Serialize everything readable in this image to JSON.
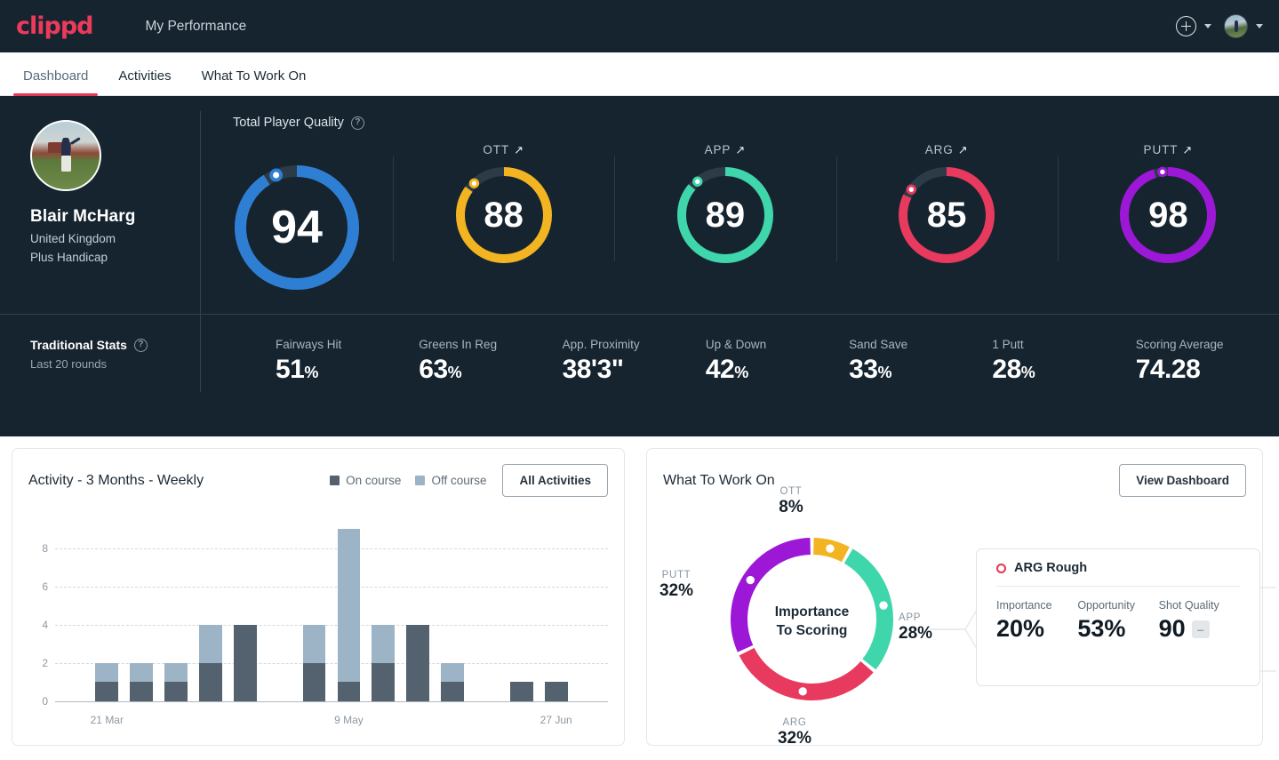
{
  "brand": {
    "logo_text": "clippd",
    "accent": "#ec3a5b"
  },
  "header": {
    "app_title": "My Performance",
    "add_icon": "plus-circle-icon",
    "chevron_icon": "chevron-down-icon",
    "avatar_icon": "user-avatar"
  },
  "tabs": [
    {
      "label": "Dashboard",
      "active": true
    },
    {
      "label": "Activities",
      "active": false
    },
    {
      "label": "What To Work On",
      "active": false
    }
  ],
  "profile": {
    "name": "Blair McHarg",
    "country": "United Kingdom",
    "handicap": "Plus Handicap"
  },
  "tpq": {
    "label": "Total Player Quality",
    "help_icon": "question-mark-icon"
  },
  "gauges": [
    {
      "title": "",
      "value": "94",
      "color": "#2e7fd4",
      "pct": 94,
      "main": true,
      "trend": ""
    },
    {
      "title": "OTT",
      "value": "88",
      "color": "#f2b521",
      "pct": 88,
      "main": false,
      "trend": "↗"
    },
    {
      "title": "APP",
      "value": "89",
      "color": "#3fd6ab",
      "pct": 89,
      "main": false,
      "trend": "↗"
    },
    {
      "title": "ARG",
      "value": "85",
      "color": "#e8395e",
      "pct": 85,
      "main": false,
      "trend": "↗"
    },
    {
      "title": "PUTT",
      "value": "98",
      "color": "#9c18d6",
      "pct": 98,
      "main": false,
      "trend": "↗"
    }
  ],
  "traditional_stats": {
    "title": "Traditional Stats",
    "help_icon": "question-mark-icon",
    "subtitle": "Last 20 rounds",
    "items": [
      {
        "label": "Fairways Hit",
        "value": "51",
        "unit": "%"
      },
      {
        "label": "Greens In Reg",
        "value": "63",
        "unit": "%"
      },
      {
        "label": "App. Proximity",
        "value": "38'3\"",
        "unit": ""
      },
      {
        "label": "Up & Down",
        "value": "42",
        "unit": "%"
      },
      {
        "label": "Sand Save",
        "value": "33",
        "unit": "%"
      },
      {
        "label": "1 Putt",
        "value": "28",
        "unit": "%"
      },
      {
        "label": "Scoring Average",
        "value": "74.28",
        "unit": ""
      }
    ]
  },
  "activity_card": {
    "title": "Activity - 3 Months - Weekly",
    "legend": [
      {
        "label": "On course",
        "color": "#53626e"
      },
      {
        "label": "Off course",
        "color": "#9db3c6"
      }
    ],
    "button": "All Activities"
  },
  "work_card": {
    "title": "What To Work On",
    "button": "View Dashboard",
    "center_line1": "Importance",
    "center_line2": "To Scoring",
    "detail": {
      "title": "ARG Rough",
      "marker_icon": "ring-dot-icon",
      "marker_color": "#e8334f",
      "metrics": [
        {
          "label": "Importance",
          "value": "20%",
          "chip": ""
        },
        {
          "label": "Opportunity",
          "value": "53%",
          "chip": ""
        },
        {
          "label": "Shot Quality",
          "value": "90",
          "chip": "–"
        }
      ]
    }
  },
  "chart_data": [
    {
      "type": "bar",
      "title": "Activity - 3 Months - Weekly",
      "stacked": true,
      "categories": [
        "",
        "21 Mar",
        "",
        "",
        "",
        "",
        "",
        "",
        "9 May",
        "",
        "",
        "",
        "",
        "",
        "27 Jun",
        ""
      ],
      "x_tick_labels": [
        {
          "label": "21 Mar",
          "index": 1
        },
        {
          "label": "9 May",
          "index": 8
        },
        {
          "label": "27 Jun",
          "index": 14
        }
      ],
      "series": [
        {
          "name": "On course",
          "color": "#53626e",
          "values": [
            0,
            1,
            1,
            1,
            2,
            4,
            0,
            2,
            1,
            2,
            4,
            1,
            0,
            1,
            1,
            0
          ]
        },
        {
          "name": "Off course",
          "color": "#9db3c6",
          "values": [
            0,
            1,
            1,
            1,
            2,
            0,
            0,
            2,
            8,
            2,
            0,
            1,
            0,
            0,
            0,
            0
          ]
        }
      ],
      "ylim": [
        0,
        9
      ],
      "y_ticks": [
        0,
        2,
        4,
        6,
        8
      ],
      "ylabel": "",
      "xlabel": "",
      "grid": true,
      "legend_position": "top-right"
    },
    {
      "type": "pie",
      "title": "Importance To Scoring",
      "donut": true,
      "labels": [
        "OTT",
        "APP",
        "ARG",
        "PUTT"
      ],
      "values": [
        8,
        28,
        32,
        32
      ],
      "value_labels": [
        "8%",
        "28%",
        "32%",
        "32%"
      ],
      "colors": [
        "#f2b521",
        "#3fd6ab",
        "#e8395e",
        "#9c18d6"
      ],
      "legend_position": "around"
    }
  ]
}
